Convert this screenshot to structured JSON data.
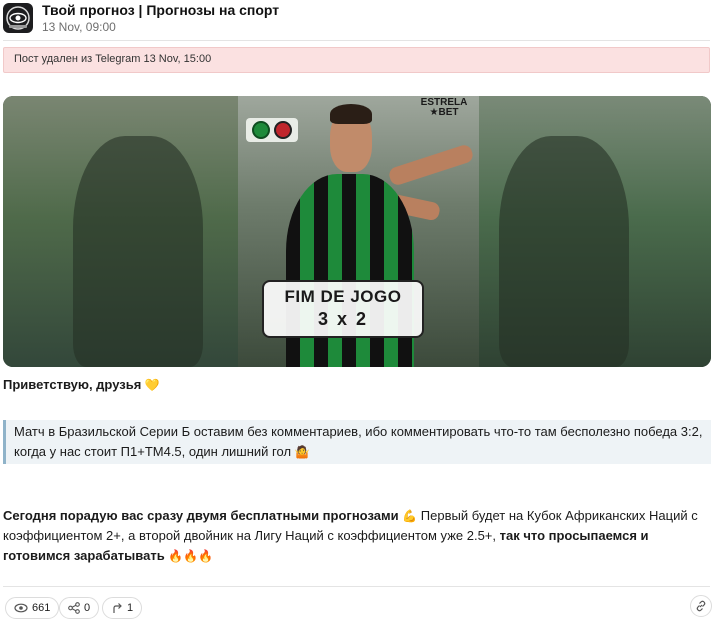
{
  "channel": {
    "name": "Твой прогноз | Прогнозы на спорт",
    "date": "13 Nov, 09:00",
    "avatar_icon": "eye-logo-icon"
  },
  "deleted_notice": {
    "prefix": "Пост удален из Telegram",
    "date": "13 Nov, 15:00"
  },
  "media": {
    "sponsor_line1": "ESTRELA",
    "sponsor_line2": "★BET",
    "score_title": "FIM DE JOGO",
    "score_value": "3 x 2",
    "colors": {
      "green": "#1e8a3a",
      "black": "#111111"
    }
  },
  "message": {
    "greeting": "Приветствую, друзья",
    "greeting_emoji": "💛",
    "quote": "Матч в Бразильской Серии Б оставим без комментариев, ибо комментировать что-то там бесполезно победа 3:2, когда у нас стоит П1+ТМ4.5, один лишний гол",
    "quote_emoji": "🤷",
    "body_bold_1": "Сегодня порадую вас сразу двумя бесплатными прогнозами",
    "body_emoji_1": "💪",
    "body_plain": " Первый будет на Кубок Африканских Наций с коэффициентом 2+, а второй двойник на Лигу Наций с коэффициентом уже 2.5+,",
    "body_bold_2": " так что просыпаемся и готовимся зарабатывать",
    "body_emoji_2": "🔥🔥🔥"
  },
  "footer": {
    "views": "661",
    "shares": "0",
    "forwards": "1",
    "icons": [
      "eye-icon",
      "share-icon",
      "forward-icon",
      "link-icon"
    ]
  }
}
